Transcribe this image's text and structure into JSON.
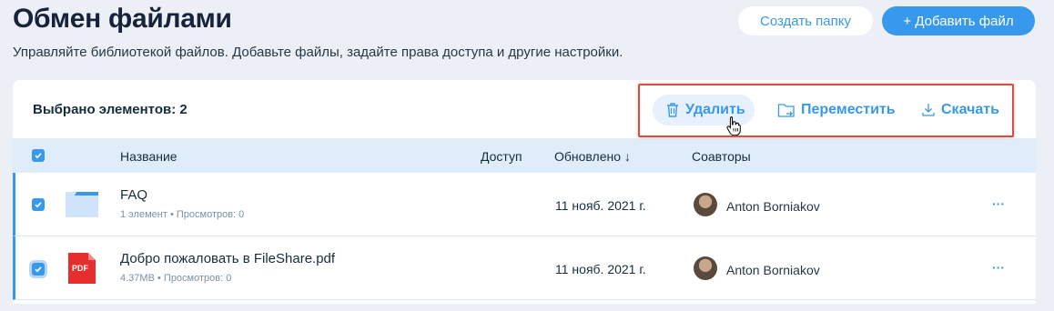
{
  "header": {
    "title": "Обмен файлами",
    "subtitle": "Управляйте библиотекой файлов. Добавьте файлы, задайте права доступа и другие настройки.",
    "create_folder_label": "Создать папку",
    "add_file_label": "+ Добавить файл"
  },
  "selection": {
    "count_label": "Выбрано элементов: 2",
    "delete_label": "Удалить",
    "move_label": "Переместить",
    "download_label": "Скачать"
  },
  "table": {
    "columns": {
      "name": "Название",
      "access": "Доступ",
      "updated": "Обновлено ↓",
      "coauthors": "Соавторы"
    },
    "rows": [
      {
        "title": "FAQ",
        "meta_count": "1 элемент",
        "meta_views": "Просмотров: 0",
        "date": "11 нояб. 2021 г.",
        "author": "Anton Borniakov",
        "type_icon": "folder-icon",
        "checked": true
      },
      {
        "title": "Добро пожаловать в FileShare.pdf",
        "meta_count": "4.37MB",
        "meta_views": "Просмотров: 0",
        "date": "11 нояб. 2021 г.",
        "author": "Anton Borniakov",
        "type_icon": "pdf-file-icon",
        "pdf_badge": "PDF",
        "checked": true
      }
    ],
    "more_label": "···"
  },
  "colors": {
    "accent": "#3899ec",
    "page_bg": "#ecf0f6",
    "header_row_bg": "#dfedfa",
    "highlight": "#e04a3f"
  }
}
